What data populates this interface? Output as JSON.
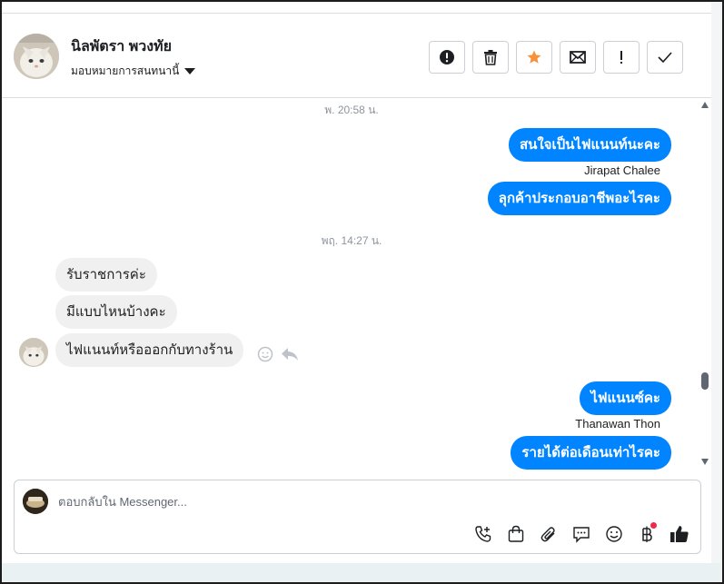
{
  "header": {
    "contact_name": "นิลพัตรา พวงทัย",
    "assign_label": "มอบหมายการสนทนานี้"
  },
  "actions": [
    {
      "name": "spam-button",
      "icon": "alert-circle-icon"
    },
    {
      "name": "delete-button",
      "icon": "trash-icon"
    },
    {
      "name": "star-button",
      "icon": "star-icon",
      "color": "#f7923b"
    },
    {
      "name": "mark-unread-button",
      "icon": "envelope-icon"
    },
    {
      "name": "follow-up-button",
      "icon": "exclamation-icon"
    },
    {
      "name": "done-button",
      "icon": "check-icon"
    }
  ],
  "thread": {
    "timestamp_1": "พ. 20:58 น.",
    "out_1": "สนใจเป็นไฟแนนท์นะคะ",
    "sender_1": "Jirapat Chalee",
    "out_2": "ลุกค้าประกอบอาชีพอะไรคะ",
    "timestamp_2": "พฤ. 14:27 น.",
    "in_1": "รับราชการค่ะ",
    "in_2": "มีแบบไหนบ้างคะ",
    "in_3": "ไฟแนนท์หรือออกกับทางร้าน",
    "out_3": "ไฟแนนซ์คะ",
    "sender_2": "Thanawan Thon",
    "out_4": "รายได้ต่อเดือนเท่าไรคะ"
  },
  "composer": {
    "placeholder": "ตอบกลับใน Messenger..."
  },
  "colors": {
    "accent": "#0084ff",
    "star": "#f7923b",
    "notification_dot": "#f02849"
  }
}
